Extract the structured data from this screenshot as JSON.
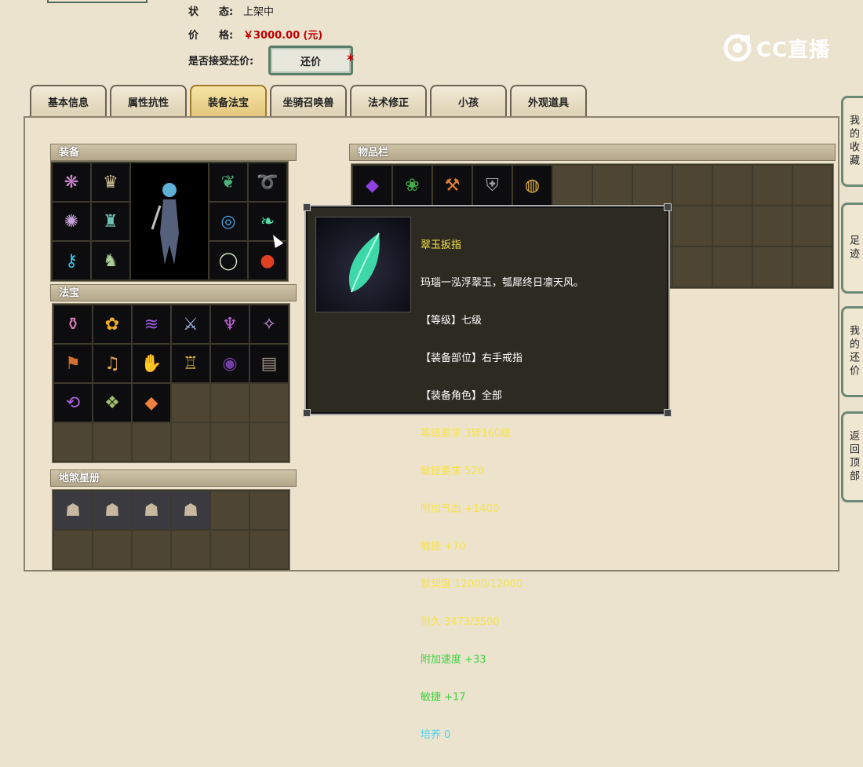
{
  "listing": {
    "status_label": "状　　态:",
    "status_value": "上架中",
    "price_label": "价　　格:",
    "price_value": "￥3000.00",
    "price_unit": "(元)",
    "counter_label": "是否接受还价:",
    "counter_button": "还价"
  },
  "brand": {
    "logo_text": "CC直播"
  },
  "tabs": [
    {
      "label": "基本信息",
      "active": false
    },
    {
      "label": "属性抗性",
      "active": false
    },
    {
      "label": "装备法宝",
      "active": true
    },
    {
      "label": "坐骑召唤兽",
      "active": false
    },
    {
      "label": "法术修正",
      "active": false
    },
    {
      "label": "小孩",
      "active": false
    },
    {
      "label": "外观道具",
      "active": false
    }
  ],
  "sections": {
    "equipment": "装备",
    "treasure": "法宝",
    "star_book": "地煞星册",
    "inventory": "物品栏"
  },
  "sidebar": [
    {
      "label": "我的收藏"
    },
    {
      "label": "足迹"
    },
    {
      "label": "我的还价"
    },
    {
      "label": "返回顶部"
    }
  ],
  "tooltip": {
    "lines": [
      {
        "text": "翠玉扳指",
        "color": "yellow"
      },
      {
        "text": "玛瑙一泓浮翠玉，瓠犀终日凛天风。",
        "color": "white"
      },
      {
        "text": "【等级】七级",
        "color": "white"
      },
      {
        "text": "【装备部位】右手戒指",
        "color": "white"
      },
      {
        "text": "【装备角色】全部",
        "color": "white"
      },
      {
        "text": "等级需求 3转160级",
        "color": "yellow"
      },
      {
        "text": "敏捷要求 520",
        "color": "yellow"
      },
      {
        "text": "附加气血 +1400",
        "color": "yellow"
      },
      {
        "text": "敏捷 +70",
        "color": "yellow"
      },
      {
        "text": "默契度 12000/12000",
        "color": "yellow"
      },
      {
        "text": "耐久 3473/3500",
        "color": "yellow"
      },
      {
        "text": "附加速度 +33",
        "color": "green"
      },
      {
        "text": "敏捷 +17",
        "color": "green"
      },
      {
        "text": "培养 0",
        "color": "cyan"
      }
    ]
  },
  "colors": {
    "price": "#c00000",
    "tab_active": "#e3c77d",
    "panel_bg": "#2c2a21"
  }
}
